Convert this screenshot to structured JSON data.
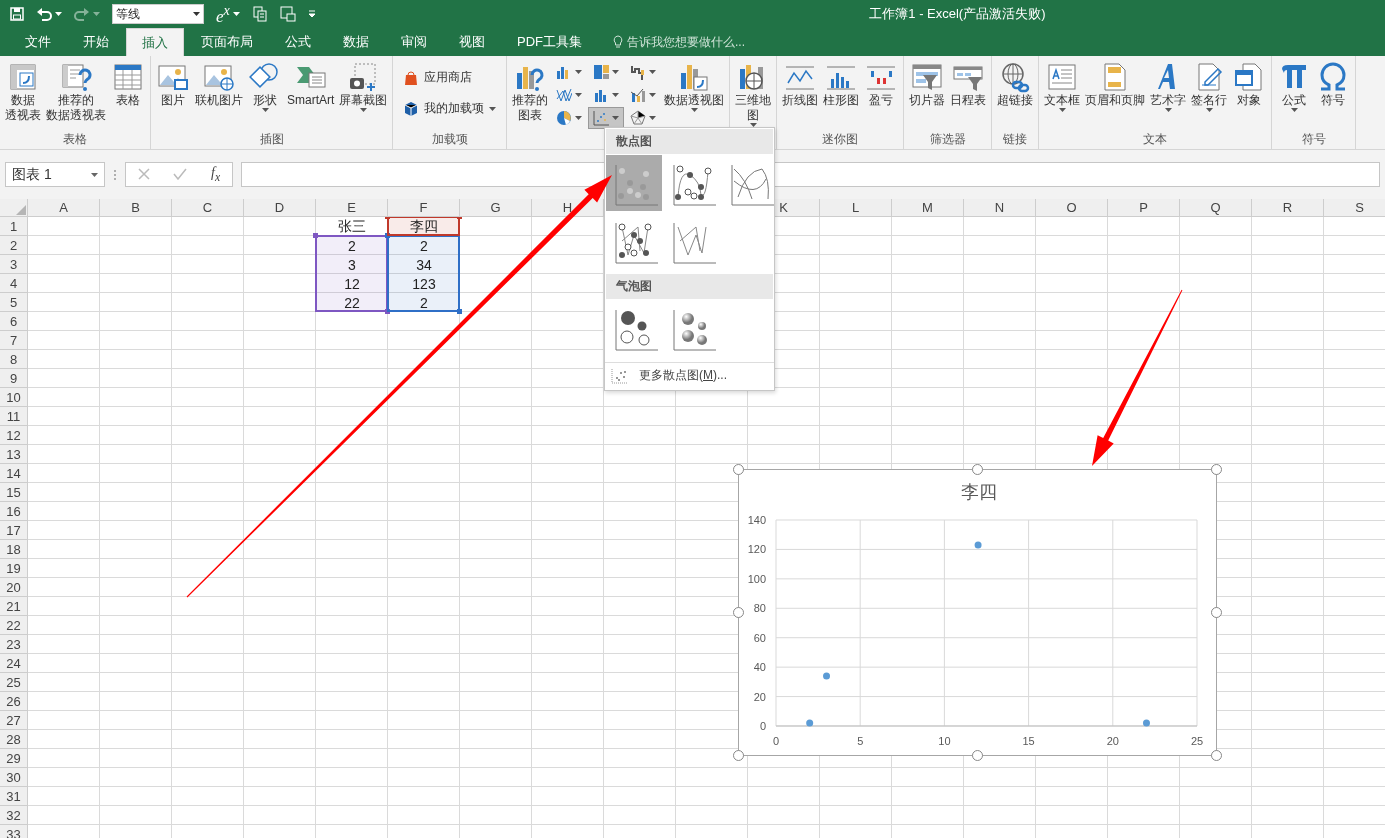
{
  "quick_access": {
    "font_box": "等线",
    "equation": "e$^{x}$",
    "redo": {
      "disabled": true
    }
  },
  "window": {
    "title": "工作簿1 - Excel(产品激活失败)"
  },
  "tabs": [
    {
      "label": "文件",
      "selected": false
    },
    {
      "label": "开始",
      "selected": false
    },
    {
      "label": "插入",
      "selected": true
    },
    {
      "label": "页面布局",
      "selected": false
    },
    {
      "label": "公式",
      "selected": false
    },
    {
      "label": "数据",
      "selected": false
    },
    {
      "label": "审阅",
      "selected": false
    },
    {
      "label": "视图",
      "selected": false
    },
    {
      "label": "PDF工具集",
      "selected": false
    }
  ],
  "tell_me": {
    "placeholder": "告诉我您想要做什么..."
  },
  "ribbon_groups": [
    {
      "label": "表格",
      "items": [
        {
          "kind": "large",
          "label_lines": [
            "数据",
            "透视表"
          ],
          "menu": false
        },
        {
          "kind": "large",
          "label_lines": [
            "推荐的",
            "数据透视表"
          ],
          "menu": false
        },
        {
          "kind": "large",
          "label": "表格",
          "menu": false
        }
      ]
    },
    {
      "label": "插图",
      "items": [
        {
          "kind": "large",
          "label": "图片",
          "menu": false
        },
        {
          "kind": "large",
          "label": "联机图片",
          "menu": false
        },
        {
          "kind": "large",
          "label": "形状",
          "menu": true
        },
        {
          "kind": "large",
          "label": "SmartArt",
          "menu": false
        },
        {
          "kind": "large",
          "label": "屏幕截图",
          "menu": true
        }
      ]
    },
    {
      "label": "加载项",
      "items": [
        {
          "kind": "small",
          "label": "应用商店",
          "menu": false
        },
        {
          "kind": "small",
          "label": "我的加载项",
          "menu": true
        }
      ]
    },
    {
      "items": [
        {
          "kind": "large",
          "label_lines": [
            "推荐的",
            "图表"
          ],
          "menu": false
        },
        {
          "kind": "icon_grid",
          "buttons": [
            {
              "selected": false
            },
            {
              "selected": false
            },
            {
              "selected": false
            },
            {
              "selected": false
            },
            {
              "selected": false
            },
            {
              "selected": false
            },
            {
              "selected": false
            },
            {
              "selected": true
            },
            {
              "selected": false
            }
          ]
        },
        {
          "kind": "large",
          "label": "数据透视图",
          "menu": true
        }
      ]
    },
    {
      "items": [
        {
          "kind": "large",
          "label_lines": [
            "三维地",
            "图"
          ],
          "menu": true
        }
      ]
    },
    {
      "label": "迷你图",
      "items": [
        {
          "kind": "large",
          "label": "折线图",
          "menu": false
        },
        {
          "kind": "large",
          "label": "柱形图",
          "menu": false
        },
        {
          "kind": "large",
          "label": "盈亏",
          "menu": false
        }
      ]
    },
    {
      "label": "筛选器",
      "items": [
        {
          "kind": "large",
          "label": "切片器",
          "menu": false
        },
        {
          "kind": "large",
          "label": "日程表",
          "menu": false
        }
      ]
    },
    {
      "label": "链接",
      "items": [
        {
          "kind": "large",
          "label": "超链接",
          "menu": false
        }
      ]
    },
    {
      "label": "文本",
      "items": [
        {
          "kind": "large",
          "label": "文本框",
          "menu": true
        },
        {
          "kind": "large",
          "label": "页眉和页脚",
          "menu": false
        },
        {
          "kind": "large",
          "label": "艺术字",
          "menu": true
        },
        {
          "kind": "large",
          "label": "签名行",
          "menu": true
        },
        {
          "kind": "large",
          "label": "对象",
          "menu": false
        }
      ]
    },
    {
      "label": "符号",
      "items": [
        {
          "kind": "large",
          "label": "公式",
          "menu": true
        },
        {
          "kind": "large",
          "label": "符号",
          "menu": false
        }
      ]
    }
  ],
  "formula_bar": {
    "name_box": "图表 1",
    "function_label": "f$_{x}$"
  },
  "sheet": {
    "columns": [
      "A",
      "B",
      "C",
      "D",
      "E",
      "F",
      "G",
      "H",
      "K",
      "L",
      "M",
      "N",
      "O",
      "P",
      "Q",
      "R",
      "S"
    ],
    "rows": [
      "1",
      "2",
      "3",
      "4",
      "5",
      "6",
      "7",
      "8",
      "9",
      "10",
      "11",
      "12",
      "13",
      "14",
      "15",
      "16",
      "17",
      "18",
      "19",
      "20",
      "21",
      "22",
      "23",
      "24",
      "25",
      "26",
      "27",
      "28",
      "29",
      "30",
      "31",
      "32",
      "33"
    ],
    "data_columns": [
      {
        "header": "张三",
        "header_highlight": false,
        "values": [
          "2",
          "3",
          "12",
          "22"
        ],
        "color": "#7e57c2"
      },
      {
        "header": "李四",
        "header_highlight": true,
        "values": [
          "2",
          "34",
          "123",
          "2"
        ],
        "color": "#2f6fc7"
      }
    ]
  },
  "chart": {
    "chart_data": {
      "type": "scatter",
      "title": "李四",
      "x": [
        2,
        3,
        12,
        22
      ],
      "series": [
        {
          "color": "#5b9bd5",
          "values": [
            2,
            34,
            123,
            2
          ]
        }
      ],
      "grid": true,
      "xlim": [
        0,
        25
      ],
      "ylim": [
        0,
        140
      ],
      "xticks": [
        0,
        5,
        10,
        15,
        20,
        25
      ],
      "yticks": [
        0,
        20,
        40,
        60,
        80,
        100,
        120,
        140
      ]
    }
  },
  "scatter_menu": {
    "sections": [
      {
        "title": "散点图",
        "items": [
          {
            "selected": true
          },
          {
            "selected": false
          },
          {
            "selected": false
          },
          {
            "selected": false
          },
          {
            "selected": false
          }
        ]
      },
      {
        "title": "气泡图",
        "items": [
          {
            "selected": false
          },
          {
            "selected": false
          }
        ]
      }
    ],
    "more": {
      "before": "更多散点图(",
      "access_key": "M",
      "after": ")..."
    }
  },
  "annotations": [
    {
      "kind": "arrow"
    },
    {
      "kind": "arrow"
    }
  ]
}
